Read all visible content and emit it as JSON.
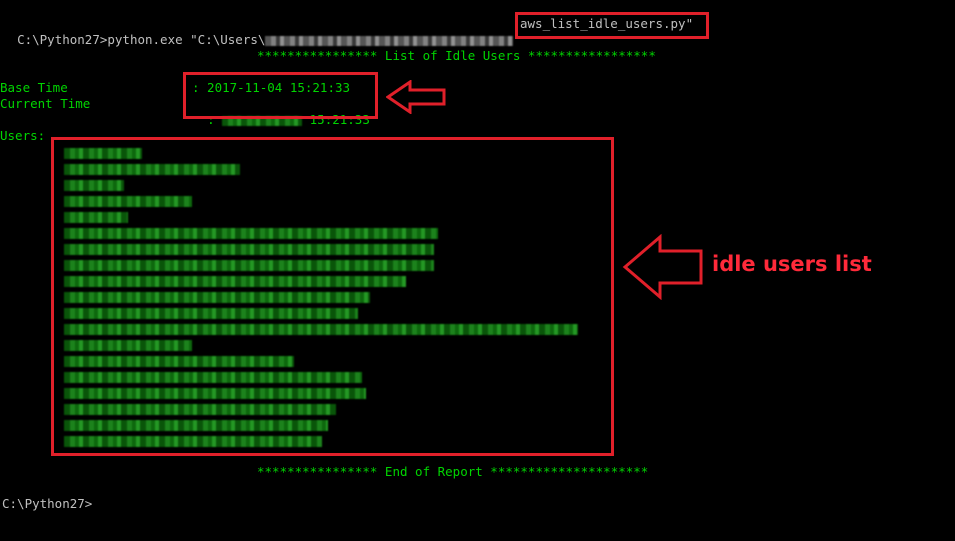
{
  "console": {
    "command_prefix": "C:\\Python27>python.exe \"C:\\Users\\",
    "script_name": "aws_list_idle_users.py\"",
    "report_header": "**************** List of Idle Users *****************",
    "base_time_label": "Base Time",
    "base_time_value": ": 2017-11-04 15:21:33",
    "current_time_label": "Current Time",
    "current_time_prefix": ":",
    "current_time_value": "15:21:33",
    "users_label": "Users:",
    "report_footer": "**************** End of Report *********************",
    "final_prompt": "C:\\Python27>"
  },
  "annotation": {
    "label": "idle users list",
    "color": "#e0202a"
  },
  "colors": {
    "background": "#000000",
    "text": "#c0c0c0",
    "green": "#00d400",
    "annotation_red": "#e0202a"
  }
}
